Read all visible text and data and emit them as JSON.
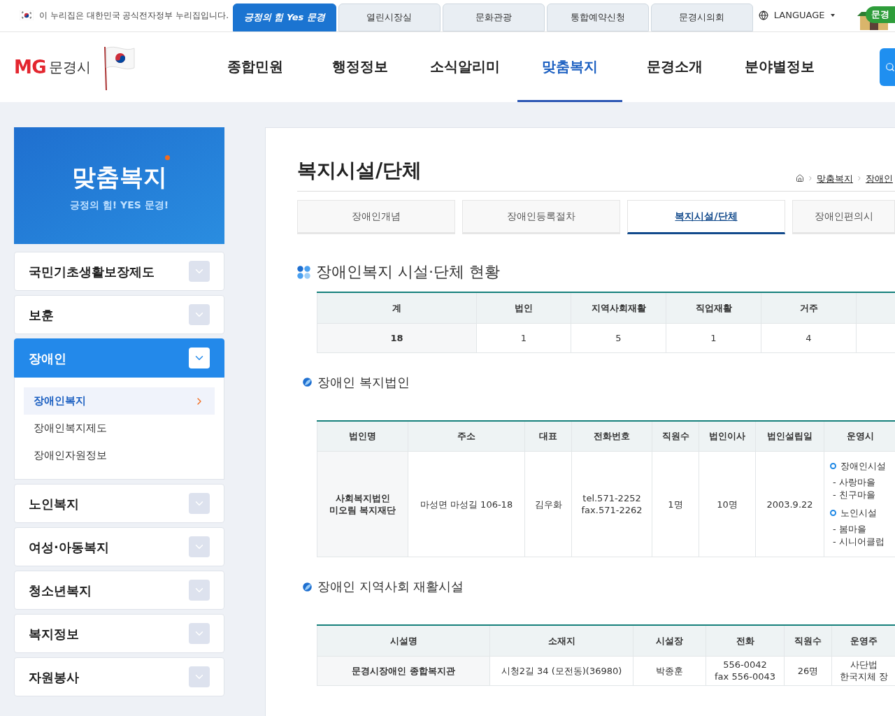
{
  "gov_notice": "이 누리집은 대한민국 공식전자정부 누리집입니다.",
  "top_tabs": [
    {
      "label": "긍정의 힘 Yes 문경",
      "selected": true
    },
    {
      "label": "열린시장실",
      "selected": false
    },
    {
      "label": "문화관광",
      "selected": false
    },
    {
      "label": "통합예약신청",
      "selected": false
    },
    {
      "label": "문경시의회",
      "selected": false
    }
  ],
  "language": "LANGUAGE",
  "mascot_badge": "문경",
  "logo": {
    "mark": "MG",
    "name": "문경시"
  },
  "nav": [
    {
      "label": "종합민원",
      "selected": false
    },
    {
      "label": "행정정보",
      "selected": false
    },
    {
      "label": "소식알리미",
      "selected": false
    },
    {
      "label": "맞춤복지",
      "selected": true
    },
    {
      "label": "문경소개",
      "selected": false
    },
    {
      "label": "분야별정보",
      "selected": false
    }
  ],
  "sidebar": {
    "banner": {
      "title": "맞춤복지",
      "subtitle": "긍정의 힘! YES 문경!"
    },
    "menu": [
      {
        "label": "국민기초생활보장제도",
        "expanded": false
      },
      {
        "label": "보훈",
        "expanded": false
      },
      {
        "label": "장애인",
        "expanded": true,
        "children": [
          {
            "label": "장애인복지",
            "selected": true
          },
          {
            "label": "장애인복지제도",
            "selected": false
          },
          {
            "label": "장애인자원정보",
            "selected": false
          }
        ]
      },
      {
        "label": "노인복지",
        "expanded": false
      },
      {
        "label": "여성·아동복지",
        "expanded": false
      },
      {
        "label": "청소년복지",
        "expanded": false
      },
      {
        "label": "복지정보",
        "expanded": false
      },
      {
        "label": "자원봉사",
        "expanded": false
      }
    ]
  },
  "content": {
    "title": "복지시설/단체",
    "breadcrumb": [
      "맞춤복지",
      "장애인"
    ],
    "tabs": [
      {
        "label": "장애인개념",
        "selected": false
      },
      {
        "label": "장애인등록절차",
        "selected": false
      },
      {
        "label": "복지시설/단체",
        "selected": true
      },
      {
        "label": "장애인편의시",
        "selected": false
      }
    ],
    "sections": [
      {
        "kind": "main",
        "heading": "장애인복지 시설·단체 현황",
        "columns": [
          "계",
          "법인",
          "지역사회재활",
          "직업재활",
          "거주"
        ],
        "rows": [
          [
            "18",
            "1",
            "5",
            "1",
            "4"
          ]
        ]
      },
      {
        "kind": "sub",
        "heading": "장애인 복지법인",
        "columns": [
          "법인명",
          "주소",
          "대표",
          "전화번호",
          "직원수",
          "법인이사",
          "법인설립일",
          "운영시"
        ],
        "rows": [
          [
            [
              "사회복지법인",
              "미오림 복지재단"
            ],
            [
              "마성면 마성길 106-18"
            ],
            [
              "김우화"
            ],
            [
              "tel.571-2252",
              "fax.571-2262"
            ],
            [
              "1명"
            ],
            [
              "10명"
            ],
            [
              "2003.9.22"
            ],
            [
              {
                "group": "장애인시설",
                "items": [
                  "- 사랑마을",
                  "- 친구마을"
                ]
              },
              {
                "group": "노인시설",
                "items": [
                  "- 봄마을",
                  "- 시니어클럽"
                ]
              }
            ]
          ]
        ]
      },
      {
        "kind": "sub",
        "heading": "장애인 지역사회 재활시설",
        "columns": [
          "시설명",
          "소재지",
          "시설장",
          "전화",
          "직원수",
          "운영주"
        ],
        "rows": [
          [
            [
              "문경시장애인 종합복지관"
            ],
            [
              "시청2길 34 (모전동)(36980)"
            ],
            [
              "박종훈"
            ],
            [
              "556-0042",
              "fax 556-0043"
            ],
            [
              "26명"
            ],
            [
              "사단법",
              "한국지체 장"
            ]
          ]
        ]
      }
    ]
  }
}
